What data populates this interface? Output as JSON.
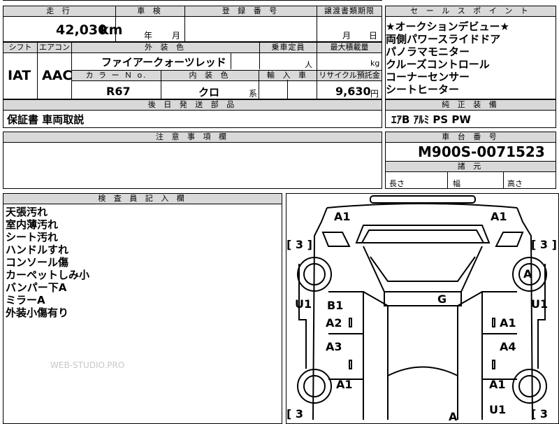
{
  "top": {
    "mileage_hdr": "走 行",
    "shaken_hdr": "車 検",
    "regno_hdr": "登 録 番 号",
    "transfer_hdr": "譲渡書類期限",
    "mileage": "42,030",
    "mileage_unit": "km",
    "year_lbl": "年",
    "month_lbl": "月",
    "t_month_lbl": "月",
    "t_day_lbl": "日"
  },
  "specs": {
    "shift_hdr": "シフト",
    "aircon_hdr": "エアコン",
    "ext_color_hdr": "外 装 色",
    "capacity_hdr": "乗車定員",
    "maxload_hdr": "最大積載量",
    "shift": "IAT",
    "aircon": "AAC",
    "ext_color": "ファイアークォーツレッド",
    "person_unit": "人",
    "kg_unit": "kg",
    "colorno_hdr": "カ ラ ー Ｎ o.",
    "int_color_hdr": "内 装 色",
    "import_hdr": "輸 入 車",
    "recycle_hdr": "リサイクル預託金",
    "colorno": "R67",
    "int_color": "クロ",
    "int_suffix": "系",
    "recycle": "9,630",
    "yen": "円"
  },
  "later": {
    "hdr": "後 日 発 送 部 品",
    "value": "保証書 車両取説"
  },
  "notes": {
    "hdr": "注 意 事 項 欄"
  },
  "sales": {
    "hdr": "セ ー ル ス ポ イ ン ト",
    "items": [
      "★オークションデビュー★",
      "両側パワースライドドア",
      "パノラマモニター",
      "クルーズコントロール",
      "コーナーセンサー",
      "シートヒーター"
    ]
  },
  "equipment": {
    "hdr": "純 正 装 備",
    "value": "ｴｱB ｱﾙﾐ PS PW"
  },
  "chassis": {
    "hdr": "車 台 番 号",
    "value": "M900S-0071523"
  },
  "dims": {
    "hdr": "諸 元",
    "length": "長さ",
    "width": "幅",
    "height": "高さ"
  },
  "inspector": {
    "hdr": "検 査 員 記 入 欄",
    "items": [
      "天張汚れ",
      "室内薄汚れ",
      "シート汚れ",
      "ハンドルすれ",
      "コンソール傷",
      "カーペットしみ小",
      "バンパー下A",
      "ミラーA",
      "外装小傷有り"
    ]
  },
  "watermark": "WEB-STUDIO.PRO",
  "diagram": {
    "a1_front_left": "A1",
    "a1_front_right": "A1",
    "tire_fl": "[ 3 ]",
    "tire_fr": "[ 3 ]",
    "tire_rl": "[ 3",
    "tire_rr": "[ 3",
    "wheel_fr": "A",
    "u1_left": "U1",
    "u1_right": "U1",
    "b1": "B1",
    "g": "G",
    "a2": "A2",
    "a1_fr_door": "A1",
    "a3": "A3",
    "a4": "A4",
    "a1_rear_left": "A1",
    "a1_rear_right": "A1",
    "u1_bottom": "U1",
    "a_rear": "A"
  }
}
